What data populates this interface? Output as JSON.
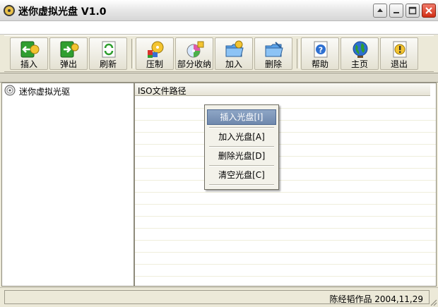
{
  "window": {
    "title": "迷你虚拟光盘 V1.0"
  },
  "toolbar": {
    "buttons": [
      {
        "label": "插入",
        "icon": "insert-icon"
      },
      {
        "label": "弹出",
        "icon": "eject-icon"
      },
      {
        "label": "刷新",
        "icon": "refresh-icon"
      },
      {
        "label": "压制",
        "icon": "compress-icon"
      },
      {
        "label": "部分收纳",
        "icon": "partial-store-icon"
      },
      {
        "label": "加入",
        "icon": "add-folder-icon"
      },
      {
        "label": "删除",
        "icon": "delete-icon"
      },
      {
        "label": "帮助",
        "icon": "help-icon"
      },
      {
        "label": "主页",
        "icon": "home-globe-icon"
      },
      {
        "label": "退出",
        "icon": "exit-icon"
      }
    ]
  },
  "tree": {
    "root_label": "迷你虚拟光驱"
  },
  "list": {
    "column_header": "ISO文件路径"
  },
  "context_menu": {
    "items": [
      {
        "label": "插入光盘[I]"
      },
      {
        "label": "加入光盘[A]"
      },
      {
        "label": "删除光盘[D]"
      },
      {
        "label": "清空光盘[C]"
      }
    ]
  },
  "status": {
    "text": "陈经韬作品 2004,11,29"
  },
  "colors": {
    "green": "#2f9e2f",
    "accent_blue": "#6f88ad",
    "close_red": "#d12e14"
  }
}
